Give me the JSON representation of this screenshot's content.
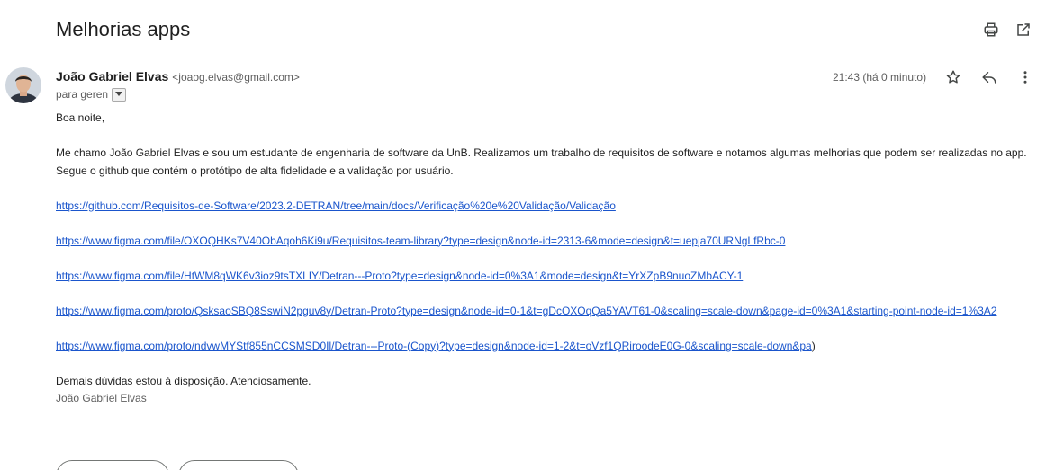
{
  "subject": "Melhorias apps",
  "sender": {
    "name": "João Gabriel Elvas",
    "email": "<joaog.elvas@gmail.com>",
    "to": "para geren"
  },
  "timestamp": "21:43 (há 0 minuto)",
  "body": {
    "greeting": "Boa noite,",
    "intro": "Me chamo João Gabriel Elvas e sou um estudante de engenharia de software da UnB. Realizamos um trabalho de requisitos de software e notamos algumas melhorias que podem ser realizadas no app. Segue o github que contém o protótipo de alta fidelidade e a validação por usuário.",
    "links": [
      "https://github.com/Requisitos-de-Software/2023.2-DETRAN/tree/main/docs/Verificação%20e%20Validação/Validação",
      "https://www.figma.com/file/OXOQHKs7V40ObAqoh6Ki9u/Requisitos-team-library?type=design&node-id=2313-6&mode=design&t=uepja70URNgLfRbc-0",
      "https://www.figma.com/file/HtWM8qWK6v3ioz9tsTXLIY/Detran---Proto?type=design&node-id=0%3A1&mode=design&t=YrXZpB9nuoZMbACY-1",
      "https://www.figma.com/proto/QsksaoSBQ8SswiN2pguv8y/Detran-Proto?type=design&node-id=0-1&t=gDcOXOqQa5YAVT61-0&scaling=scale-down&page-id=0%3A1&starting-point-node-id=1%3A2",
      "https://www.figma.com/proto/ndvwMYStf855nCCSMSD0Il/Detran---Proto-(Copy)?type=design&node-id=1-2&t=oVzf1QRiroodeE0G-0&scaling=scale-down&pa"
    ],
    "link5_suffix": ")",
    "closing": "Demais dúvidas estou à disposição. Atenciosamente.",
    "signature": "João Gabriel Elvas"
  },
  "icons": {
    "print": "print-icon",
    "open_new_window": "open-in-new-window-icon",
    "star": "star-icon",
    "reply": "reply-icon",
    "more": "more-vertical-icon",
    "dropdown": "chevron-down-icon"
  },
  "colors": {
    "link": "#1a55cc",
    "text": "#222222",
    "secondary_text": "#5e5e5e"
  }
}
